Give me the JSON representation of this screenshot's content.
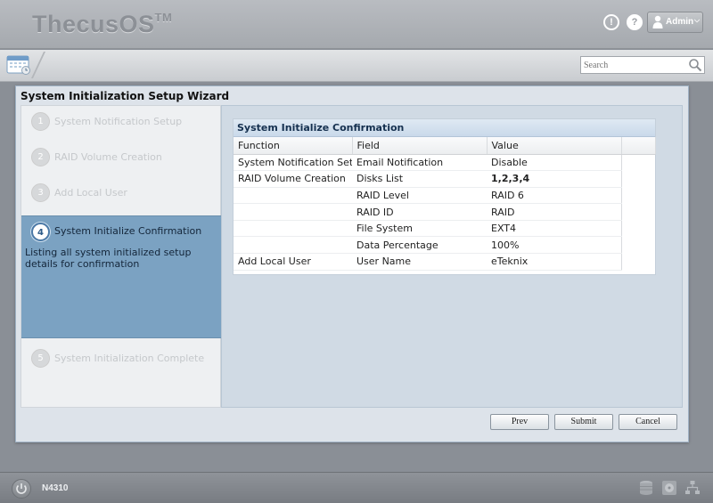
{
  "header": {
    "logo": "ThecusOS",
    "logo_tm": "TM",
    "alert_glyph": "!",
    "help_glyph": "?",
    "user_label": "Admin"
  },
  "toolbar": {
    "search_placeholder": "Search"
  },
  "wizard": {
    "title": "System Initialization Setup Wizard",
    "steps": [
      {
        "num": "1",
        "label": "System Notification Setup"
      },
      {
        "num": "2",
        "label": "RAID Volume Creation"
      },
      {
        "num": "3",
        "label": "Add Local User"
      },
      {
        "num": "4",
        "label": "System Initialize Confirmation",
        "desc": "Listing all system initialized setup details for confirmation"
      },
      {
        "num": "5",
        "label": "System Initialization Complete"
      }
    ],
    "active_step": 4,
    "panel_title": "System Initialize Confirmation",
    "columns": [
      "Function",
      "Field",
      "Value"
    ],
    "rows": [
      {
        "function": "System Notification Setup",
        "field": "Email Notification",
        "value": "Disable"
      },
      {
        "function": "RAID Volume Creation",
        "field": "Disks List",
        "value": "1,2,3,4"
      },
      {
        "function": "",
        "field": "RAID Level",
        "value": "RAID 6"
      },
      {
        "function": "",
        "field": "RAID ID",
        "value": "RAID"
      },
      {
        "function": "",
        "field": "File System",
        "value": "EXT4"
      },
      {
        "function": "",
        "field": "Data Percentage",
        "value": "100%"
      },
      {
        "function": "Add Local User",
        "field": "User Name",
        "value": "eTeknix"
      }
    ],
    "buttons": {
      "prev": "Prev",
      "submit": "Submit",
      "cancel": "Cancel"
    }
  },
  "footer": {
    "model": "N4310"
  },
  "colors": {
    "accent": "#7ba2c2",
    "header_bg": "#a9adb2",
    "panel_head": "#15304f"
  }
}
